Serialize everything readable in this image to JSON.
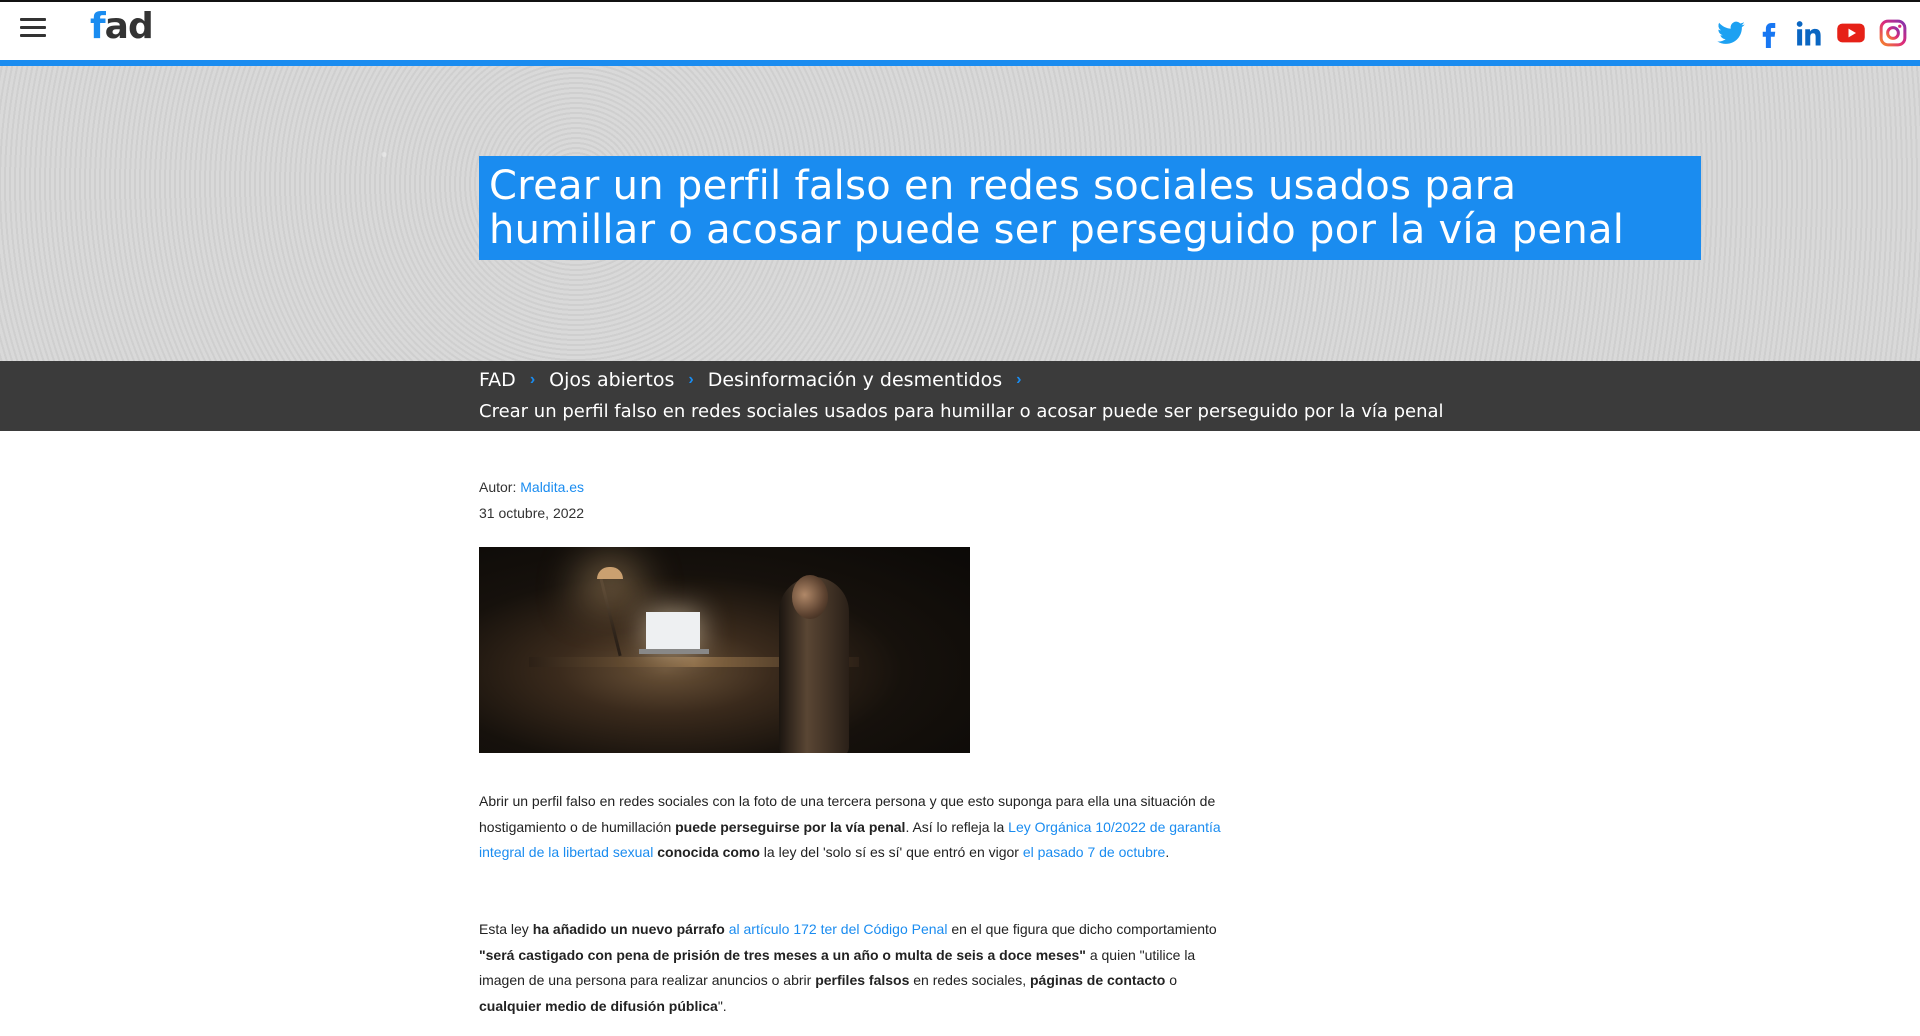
{
  "header": {
    "logo_prefix": "f",
    "logo_rest": "ad",
    "social": [
      {
        "name": "twitter-icon",
        "color": "#1da1f2"
      },
      {
        "name": "facebook-icon",
        "color": "#1877f2"
      },
      {
        "name": "linkedin-icon",
        "color": "#0a66c2"
      },
      {
        "name": "youtube-icon",
        "color": "#e62117"
      },
      {
        "name": "instagram-icon",
        "color": "#c13584"
      }
    ]
  },
  "hero": {
    "title": "Crear un perfil falso en redes sociales usados para humillar o acosar puede ser perseguido por la vía penal"
  },
  "breadcrumb": {
    "items": [
      "FAD",
      "Ojos abiertos",
      "Desinformación y desmentidos"
    ],
    "current": "Crear un perfil falso en redes sociales usados para humillar o acosar puede ser perseguido por la vía penal"
  },
  "article": {
    "author_label": "Autor:",
    "author_name": "Maldita.es",
    "date": "31 octubre, 2022",
    "p1": {
      "t1": "Abrir un perfil falso en redes sociales con la foto de una tercera persona y que esto suponga para ella una situación de hostigamiento o de humillación ",
      "b1": "puede perseguirse por la vía penal",
      "t2": ". Así lo refleja la ",
      "l1": "Ley Orgánica 10/2022 de garantía integral de la libertad sexual",
      "t3": " ",
      "b2": "conocida como",
      "t4": " la ley del 'solo sí es sí' que entró en vigor ",
      "l2": "el pasado 7 de octubre",
      "t5": "."
    },
    "p2": {
      "t1": "Esta ley ",
      "b1": "ha añadido un nuevo párrafo",
      "t2": " ",
      "l1": "al artículo 172 ter del Código Penal",
      "t3": " en el que figura que dicho comportamiento ",
      "b2": "\"será castigado con pena de prisión de tres meses a un año o multa de seis a doce meses\"",
      "t4": " a quien \"utilice la imagen de una persona para realizar anuncios o abrir ",
      "b3": "perfiles falsos",
      "t5": " en redes sociales, ",
      "b4": "páginas de contacto",
      "t6": " o ",
      "b5": "cualquier medio de difusión pública",
      "t7": "\"."
    }
  },
  "colors": {
    "accent": "#1a8cf0",
    "crumb_bar": "#3b3b3b"
  }
}
